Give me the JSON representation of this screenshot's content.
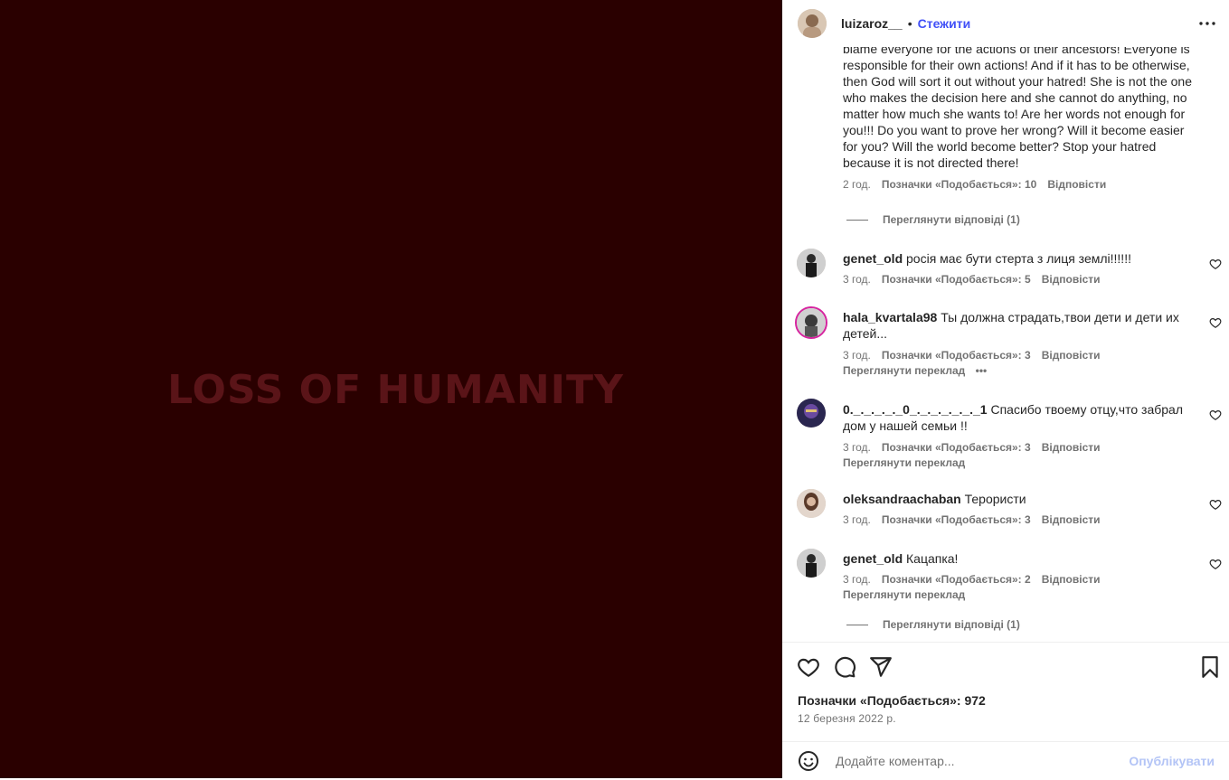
{
  "media": {
    "title": "LOSS OF HUMANITY"
  },
  "header": {
    "username": "luizaroz__",
    "separator": "•",
    "follow_label": "Стежити"
  },
  "comments": [
    {
      "text": "blame everyone for the actions of their ancestors! Everyone is responsible for their own actions! And if it has to be otherwise, then God will sort it out without your hatred! She is not the one who makes the decision here and she cannot do anything, no matter how much she wants to! Are her words not enough for you!!! Do you want to prove her wrong? Will it become easier for you? Will the world become better? Stop your hatred because it is not directed there!",
      "time": "2 год.",
      "likes": "Позначки «Подобається»: 10",
      "reply": "Відповісти",
      "view_replies": "Переглянути відповіді (1)"
    },
    {
      "username": "genet_old",
      "text": "росія має бути стерта з лиця землі!!!!!!",
      "time": "3 год.",
      "likes": "Позначки «Подобається»: 5",
      "reply": "Відповісти"
    },
    {
      "username": "hala_kvartala98",
      "text": "Ты должна страдать,твои дети и дети их детей...",
      "time": "3 год.",
      "likes": "Позначки «Подобається»: 3",
      "reply": "Відповісти",
      "translate": "Переглянути переклад",
      "more": "•••"
    },
    {
      "username": "0._._._._._0_._._._._._._1",
      "text": "Спасибо твоему отцу,что забрал дом у нашей семьи !!",
      "time": "3 год.",
      "likes": "Позначки «Подобається»: 3",
      "reply": "Відповісти",
      "translate": "Переглянути переклад"
    },
    {
      "username": "oleksandraachaban",
      "text": "Терористи",
      "time": "3 год.",
      "likes": "Позначки «Подобається»: 3",
      "reply": "Відповісти"
    },
    {
      "username": "genet_old",
      "text": "Кацапка!",
      "time": "3 год.",
      "likes": "Позначки «Подобається»: 2",
      "reply": "Відповісти",
      "translate": "Переглянути переклад",
      "view_replies": "Переглянути відповіді (1)"
    }
  ],
  "footer": {
    "likes_total": "Позначки «Подобається»: 972",
    "date": "12 березня 2022 р.",
    "comment_placeholder": "Додайте коментар...",
    "publish_label": "Опублікувати"
  },
  "colors": {
    "media_bg": "#2a0000",
    "media_text": "#5a1418",
    "accent": "#4150f7",
    "publish_disabled": "#b3c4f6"
  },
  "icons": [
    "more-options-icon",
    "heart-icon",
    "comment-icon",
    "share-icon",
    "bookmark-icon",
    "emoji-icon"
  ]
}
